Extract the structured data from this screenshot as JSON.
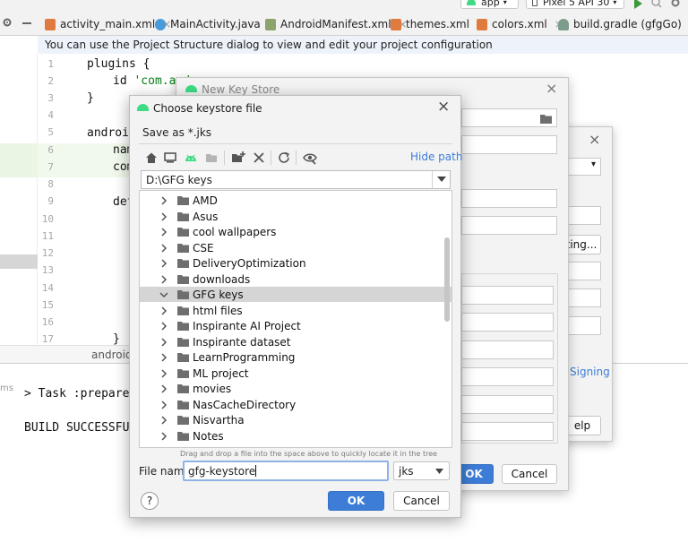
{
  "toolbar": {
    "run_config": "app",
    "device": "Pixel 5 API 30"
  },
  "tabs": [
    {
      "label": "activity_main.xml",
      "color": "#e07b3f"
    },
    {
      "label": "MainActivity.java",
      "color": "#4a9bd9"
    },
    {
      "label": "AndroidManifest.xml",
      "color": "#8ca36b"
    },
    {
      "label": "themes.xml",
      "color": "#e07b3f"
    },
    {
      "label": "colors.xml",
      "color": "#e07b3f"
    },
    {
      "label": "build.gradle (gfgGo)",
      "color": "#7c9c8c"
    }
  ],
  "info_bar": "You can use the Project Structure dialog to view and edit your project configuration",
  "editor": {
    "line_numbers": [
      "1",
      "2",
      "3",
      "4",
      "5",
      "6",
      "7",
      "8",
      "9",
      "10",
      "11",
      "12",
      "13",
      "14",
      "15",
      "16",
      "17"
    ],
    "code": {
      "plugins": "plugins {",
      "id_kw": "id ",
      "id_val": "'com.and",
      "close1": "}",
      "android": "android",
      "nam": "nam",
      "com": "com",
      "def": "def",
      "close17": "}"
    },
    "breadcrumb": "android{}"
  },
  "build_output": {
    "ms_label": "ms",
    "task": "> Task :prepareKo",
    "result": "BUILD SUCCESSFUL"
  },
  "new_key_store": {
    "title": "New Key Store",
    "ok": "OK",
    "cancel": "Cancel"
  },
  "back_dialog": {
    "btn_existing": "ting...",
    "signing": "Signing",
    "help": "elp"
  },
  "choose_keystore": {
    "title": "Choose keystore file",
    "save_as": "Save as *.jks",
    "hide_path": "Hide path",
    "path": "D:\\GFG keys",
    "folders": [
      "AMD",
      "Asus",
      "cool wallpapers",
      "CSE",
      "DeliveryOptimization",
      "downloads",
      "GFG keys",
      "html files",
      "Inspirante AI Project",
      "Inspirante dataset",
      "LearnProgramming",
      "ML project",
      "movies",
      "NasCacheDirectory",
      "Nisvartha",
      "Notes"
    ],
    "selected_folder": "GFG keys",
    "hint": "Drag and drop a file into the space above to quickly locate it in the tree",
    "file_name_label": "File name:",
    "file_name_value": "gfg-keystore",
    "extension": "jks",
    "help": "?",
    "ok": "OK",
    "cancel": "Cancel"
  },
  "colors": {
    "accent": "#3d7dd8",
    "android_green": "#3ddc84",
    "selection": "#d5d5d5",
    "string_green": "#067d17"
  }
}
